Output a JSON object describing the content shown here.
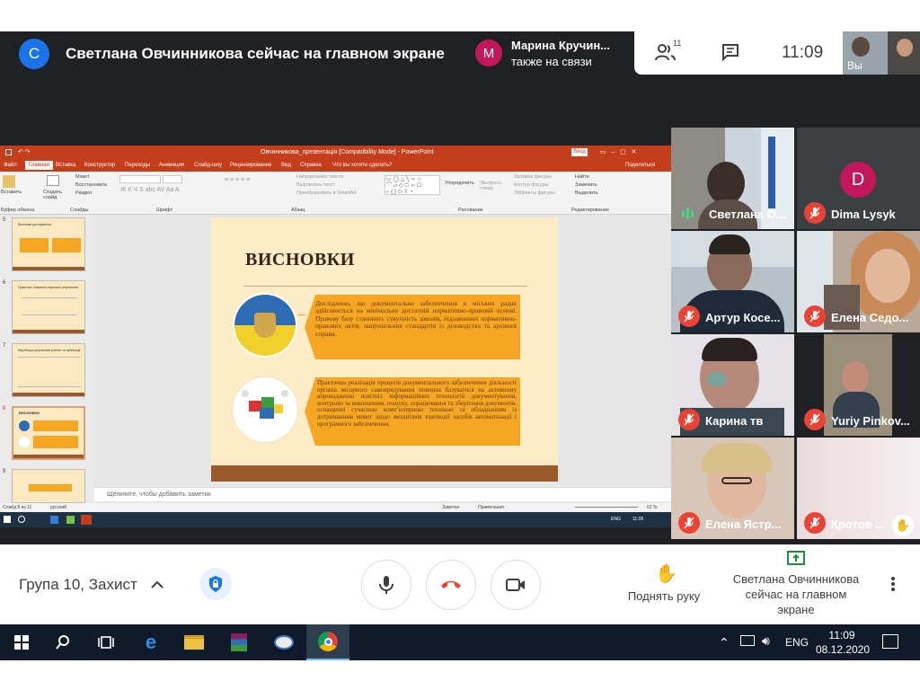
{
  "meet": {
    "presenter_initial": "С",
    "presenter_banner": "Светлана Овчинникова сейчас на главном экране",
    "joined_initial": "М",
    "joined_name": "Марина Кручин...",
    "joined_status": "также на связи",
    "participants_count": "11",
    "clock": "11:09",
    "self_label": "Вы",
    "meeting_name": "Група 10, Захист",
    "raise_hand_label": "Поднять руку",
    "presenting_label": "Светлана Овчинникова сейчас на главном экране",
    "colors": {
      "accent": "#1a73e8",
      "danger": "#ea4335",
      "dark": "#202124",
      "presenter_avatar": "#1a73e8",
      "joined_avatar": "#c2185b"
    }
  },
  "participants": [
    {
      "name": "Светлана О...",
      "mic": "speaking"
    },
    {
      "name": "Dima Lysyk",
      "mic": "off",
      "initial": "D"
    },
    {
      "name": "Артур Косе...",
      "mic": "off"
    },
    {
      "name": "Елена Седо...",
      "mic": "off"
    },
    {
      "name": "Карина тв",
      "mic": "off"
    },
    {
      "name": "Yuriy Pinkov...",
      "mic": "off"
    },
    {
      "name": "Елена Ястр...",
      "mic": "off"
    },
    {
      "name": "Кротов ...",
      "mic": "off"
    }
  ],
  "powerpoint": {
    "window_title": "Овчинникова_презентація [Compatibility Mode]  -  PowerPoint",
    "signin_label": "Вход",
    "tabs": [
      "Файл",
      "Главная",
      "Вставка",
      "Конструктор",
      "Переходы",
      "Анимация",
      "Слайд-шоу",
      "Рецензирование",
      "Вид",
      "Справка",
      "Что вы хотите сделать?",
      "Поделиться"
    ],
    "ribbon_groups": [
      "Буфер обмена",
      "Слайды",
      "Шрифт",
      "Абзац",
      "Рисование",
      "Редактирование"
    ],
    "ribbon_buttons": {
      "paste": "Вставить",
      "new_slide": "Создать слайд",
      "layout": "Макет",
      "reset": "Восстановить",
      "section": "Раздел",
      "arrange": "Упорядочить",
      "quick_styles": "Экспресс-стили",
      "find": "Найти",
      "replace": "Заменить",
      "select": "Выделить",
      "text_direction": "Направление текста",
      "align_text": "Выровнять текст",
      "smartart": "Преобразовать в SmartArt",
      "shape_fill": "Заливка фигуры",
      "shape_outline": "Контур фигуры",
      "shape_effects": "Эффекты фигуры"
    },
    "thumbnails": [
      {
        "num": "5",
        "title": "Висновки дослідження"
      },
      {
        "num": "6",
        "title": "Практичні значення наукових результатів"
      },
      {
        "num": "7",
        "title": "Апробація результатів роботи та публікації"
      },
      {
        "num": "8",
        "title": "ВИСНОВКИ"
      },
      {
        "num": "9",
        "title": ""
      }
    ],
    "slide": {
      "title": "ВИСНОВКИ",
      "para1": "Досліджено, що документальне забезпечення в міських радах здійснюється на мінімально достатній нормативно-правовій основі. Правову базу становить сукупність законів, підзаконних нормативно-правових актів, національних стандартів із діловодства та архівної справи.",
      "para2": "Практична реалізація процесів документального забезпечення діяльності органів місцевого самоврядування повинна базуватися на активному впровадженні новітніх інформаційних технологій документування, контролю за виконанням, пошуку, опрацювання та зберігання документів, оснащенні сучасною комп’ютерною технікою та обладнанням із дотриманням вимог щодо механізмів взаємодії засобів автоматизації і програмного забезпечення."
    },
    "notes_placeholder": "Щелкните, чтобы добавить заметки",
    "status_left": "Слайд 8 из 11",
    "status_lang": "русский",
    "status_notes": "Заметки",
    "status_comments": "Примечания",
    "zoom": "62 %",
    "inner_clock": "11:09",
    "inner_lang": "ENG"
  },
  "taskbar": {
    "lang": "ENG",
    "time": "11:09",
    "date": "08.12.2020",
    "apps": [
      "windows-start",
      "search",
      "task-view",
      "edge",
      "file-explorer",
      "winrar",
      "paint",
      "chrome"
    ]
  }
}
